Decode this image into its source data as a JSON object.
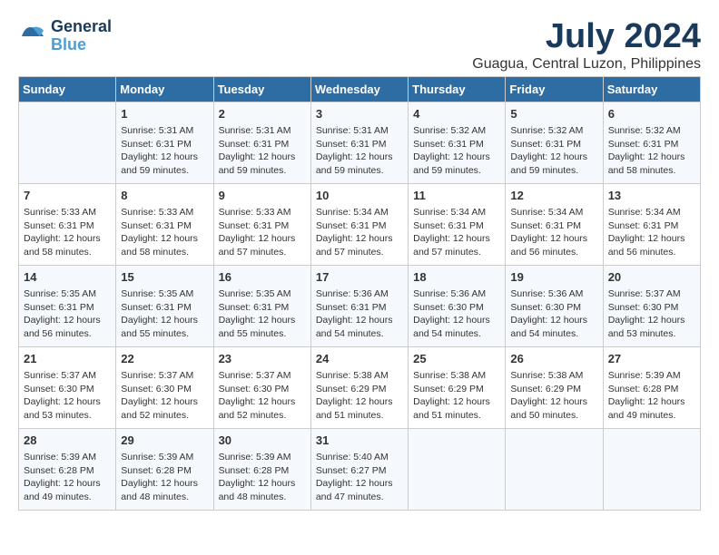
{
  "logo": {
    "text_general": "General",
    "text_blue": "Blue"
  },
  "title": {
    "month_year": "July 2024",
    "location": "Guagua, Central Luzon, Philippines"
  },
  "weekdays": [
    "Sunday",
    "Monday",
    "Tuesday",
    "Wednesday",
    "Thursday",
    "Friday",
    "Saturday"
  ],
  "weeks": [
    [
      {
        "day": "",
        "info": ""
      },
      {
        "day": "1",
        "info": "Sunrise: 5:31 AM\nSunset: 6:31 PM\nDaylight: 12 hours\nand 59 minutes."
      },
      {
        "day": "2",
        "info": "Sunrise: 5:31 AM\nSunset: 6:31 PM\nDaylight: 12 hours\nand 59 minutes."
      },
      {
        "day": "3",
        "info": "Sunrise: 5:31 AM\nSunset: 6:31 PM\nDaylight: 12 hours\nand 59 minutes."
      },
      {
        "day": "4",
        "info": "Sunrise: 5:32 AM\nSunset: 6:31 PM\nDaylight: 12 hours\nand 59 minutes."
      },
      {
        "day": "5",
        "info": "Sunrise: 5:32 AM\nSunset: 6:31 PM\nDaylight: 12 hours\nand 59 minutes."
      },
      {
        "day": "6",
        "info": "Sunrise: 5:32 AM\nSunset: 6:31 PM\nDaylight: 12 hours\nand 58 minutes."
      }
    ],
    [
      {
        "day": "7",
        "info": "Sunrise: 5:33 AM\nSunset: 6:31 PM\nDaylight: 12 hours\nand 58 minutes."
      },
      {
        "day": "8",
        "info": "Sunrise: 5:33 AM\nSunset: 6:31 PM\nDaylight: 12 hours\nand 58 minutes."
      },
      {
        "day": "9",
        "info": "Sunrise: 5:33 AM\nSunset: 6:31 PM\nDaylight: 12 hours\nand 57 minutes."
      },
      {
        "day": "10",
        "info": "Sunrise: 5:34 AM\nSunset: 6:31 PM\nDaylight: 12 hours\nand 57 minutes."
      },
      {
        "day": "11",
        "info": "Sunrise: 5:34 AM\nSunset: 6:31 PM\nDaylight: 12 hours\nand 57 minutes."
      },
      {
        "day": "12",
        "info": "Sunrise: 5:34 AM\nSunset: 6:31 PM\nDaylight: 12 hours\nand 56 minutes."
      },
      {
        "day": "13",
        "info": "Sunrise: 5:34 AM\nSunset: 6:31 PM\nDaylight: 12 hours\nand 56 minutes."
      }
    ],
    [
      {
        "day": "14",
        "info": "Sunrise: 5:35 AM\nSunset: 6:31 PM\nDaylight: 12 hours\nand 56 minutes."
      },
      {
        "day": "15",
        "info": "Sunrise: 5:35 AM\nSunset: 6:31 PM\nDaylight: 12 hours\nand 55 minutes."
      },
      {
        "day": "16",
        "info": "Sunrise: 5:35 AM\nSunset: 6:31 PM\nDaylight: 12 hours\nand 55 minutes."
      },
      {
        "day": "17",
        "info": "Sunrise: 5:36 AM\nSunset: 6:31 PM\nDaylight: 12 hours\nand 54 minutes."
      },
      {
        "day": "18",
        "info": "Sunrise: 5:36 AM\nSunset: 6:30 PM\nDaylight: 12 hours\nand 54 minutes."
      },
      {
        "day": "19",
        "info": "Sunrise: 5:36 AM\nSunset: 6:30 PM\nDaylight: 12 hours\nand 54 minutes."
      },
      {
        "day": "20",
        "info": "Sunrise: 5:37 AM\nSunset: 6:30 PM\nDaylight: 12 hours\nand 53 minutes."
      }
    ],
    [
      {
        "day": "21",
        "info": "Sunrise: 5:37 AM\nSunset: 6:30 PM\nDaylight: 12 hours\nand 53 minutes."
      },
      {
        "day": "22",
        "info": "Sunrise: 5:37 AM\nSunset: 6:30 PM\nDaylight: 12 hours\nand 52 minutes."
      },
      {
        "day": "23",
        "info": "Sunrise: 5:37 AM\nSunset: 6:30 PM\nDaylight: 12 hours\nand 52 minutes."
      },
      {
        "day": "24",
        "info": "Sunrise: 5:38 AM\nSunset: 6:29 PM\nDaylight: 12 hours\nand 51 minutes."
      },
      {
        "day": "25",
        "info": "Sunrise: 5:38 AM\nSunset: 6:29 PM\nDaylight: 12 hours\nand 51 minutes."
      },
      {
        "day": "26",
        "info": "Sunrise: 5:38 AM\nSunset: 6:29 PM\nDaylight: 12 hours\nand 50 minutes."
      },
      {
        "day": "27",
        "info": "Sunrise: 5:39 AM\nSunset: 6:28 PM\nDaylight: 12 hours\nand 49 minutes."
      }
    ],
    [
      {
        "day": "28",
        "info": "Sunrise: 5:39 AM\nSunset: 6:28 PM\nDaylight: 12 hours\nand 49 minutes."
      },
      {
        "day": "29",
        "info": "Sunrise: 5:39 AM\nSunset: 6:28 PM\nDaylight: 12 hours\nand 48 minutes."
      },
      {
        "day": "30",
        "info": "Sunrise: 5:39 AM\nSunset: 6:28 PM\nDaylight: 12 hours\nand 48 minutes."
      },
      {
        "day": "31",
        "info": "Sunrise: 5:40 AM\nSunset: 6:27 PM\nDaylight: 12 hours\nand 47 minutes."
      },
      {
        "day": "",
        "info": ""
      },
      {
        "day": "",
        "info": ""
      },
      {
        "day": "",
        "info": ""
      }
    ]
  ]
}
